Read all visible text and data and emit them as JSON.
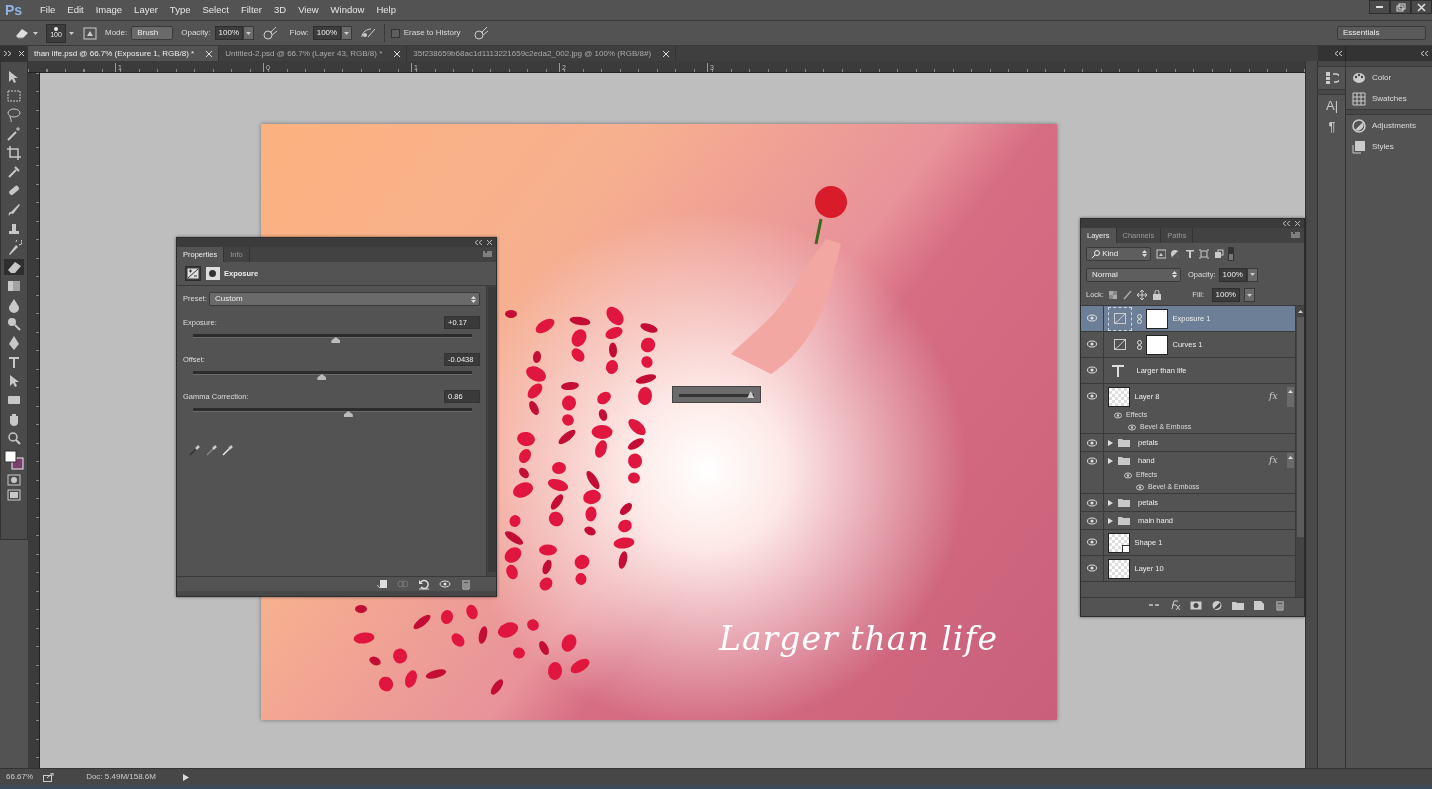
{
  "app": {
    "logo": "Ps"
  },
  "menu": [
    "File",
    "Edit",
    "Image",
    "Layer",
    "Type",
    "Select",
    "Filter",
    "3D",
    "View",
    "Window",
    "Help"
  ],
  "options_bar": {
    "brush_size": "100",
    "mode_label": "Mode:",
    "mode": "Brush",
    "opacity_label": "Opacity:",
    "opacity": "100%",
    "flow_label": "Flow:",
    "flow": "100%",
    "erase_to_history": {
      "label": "Erase to History",
      "checked": false
    },
    "workspace": "Essentials"
  },
  "doc_tabs": [
    {
      "title": "than life.psd @ 66.7% (Exposure 1, RGB/8) *",
      "selected": true
    },
    {
      "title": "Untitled-2.psd @ 66.7% (Layer 43, RGB/8) *",
      "selected": false
    },
    {
      "title": "35f238659b68ac1d1113221659c2eda2_002.jpg @ 100% (RGB/8#)",
      "selected": false
    }
  ],
  "ruler_labels": [
    "1",
    "0",
    "1",
    "2",
    "3"
  ],
  "tools": [
    {
      "selected": false
    },
    {
      "selected": false
    },
    {
      "selected": false
    },
    {
      "selected": false
    },
    {
      "selected": false
    },
    {
      "selected": false
    },
    {
      "selected": false
    },
    {
      "selected": false
    },
    {
      "selected": false
    },
    {
      "selected": false
    },
    {
      "selected": true
    },
    {
      "selected": false
    },
    {
      "selected": false
    },
    {
      "selected": false
    },
    {
      "selected": false
    },
    {
      "selected": false
    },
    {
      "selected": false
    },
    {
      "selected": false
    },
    {
      "selected": false
    },
    {
      "selected": false
    }
  ],
  "canvas": {
    "text": "Larger than life",
    "hud_slider": {
      "level": 0.95
    }
  },
  "properties": {
    "tabs": [
      {
        "label": "Properties",
        "selected": true
      },
      {
        "label": "Info",
        "selected": false
      }
    ],
    "title": "Exposure",
    "preset_label": "Preset:",
    "preset": "Custom",
    "sliders": [
      {
        "label": "Exposure:",
        "value": "+0.17",
        "level": 0.51
      },
      {
        "label": "Offset:",
        "value": "-0.0438",
        "level": 0.46
      },
      {
        "label": "Gamma Correction:",
        "value": "0.86",
        "level": 0.555
      }
    ]
  },
  "layers": {
    "tabs": [
      {
        "label": "Layers",
        "selected": true
      },
      {
        "label": "Channels",
        "selected": false
      },
      {
        "label": "Paths",
        "selected": false
      }
    ],
    "filter": "Kind",
    "blend_mode": "Normal",
    "opacity_label": "Opacity:",
    "opacity": "100%",
    "lock_label": "Lock:",
    "fill_label": "Fill:",
    "fill": "100%",
    "items": [
      {
        "kind": "adjustment",
        "name": "Exposure 1",
        "visible": true,
        "selected": true
      },
      {
        "kind": "adjustment",
        "name": "Curves 1",
        "visible": true,
        "selected": false
      },
      {
        "kind": "text",
        "name": "Larger than life",
        "visible": true,
        "selected": false
      },
      {
        "kind": "pixel",
        "name": "Layer 8",
        "visible": true,
        "selected": false,
        "fx": "fx",
        "effects_label": "Effects",
        "effects": [
          "Bevel & Emboss"
        ]
      },
      {
        "kind": "group",
        "name": "petals",
        "visible": true,
        "selected": false,
        "expanded": false
      },
      {
        "kind": "group",
        "name": "hand",
        "visible": true,
        "selected": false,
        "expanded": false,
        "fx": "fx",
        "effects_label": "Effects",
        "effects": [
          "Bevel & Emboss"
        ]
      },
      {
        "kind": "group",
        "name": "petals",
        "visible": true,
        "selected": false,
        "expanded": false
      },
      {
        "kind": "group",
        "name": "main hand",
        "visible": true,
        "selected": false,
        "expanded": false
      },
      {
        "kind": "shape",
        "name": "Shape 1",
        "visible": true,
        "selected": false
      },
      {
        "kind": "pixel",
        "name": "Layer 10",
        "visible": true,
        "selected": false
      }
    ]
  },
  "right_dock": {
    "glyph_buttons": [
      "A|",
      "¶"
    ],
    "panels": [
      "Color",
      "Swatches",
      "Adjustments",
      "Styles"
    ]
  },
  "status_bar": {
    "zoom": "66.67%",
    "doc": "Doc: 5.49M/158.6M"
  }
}
